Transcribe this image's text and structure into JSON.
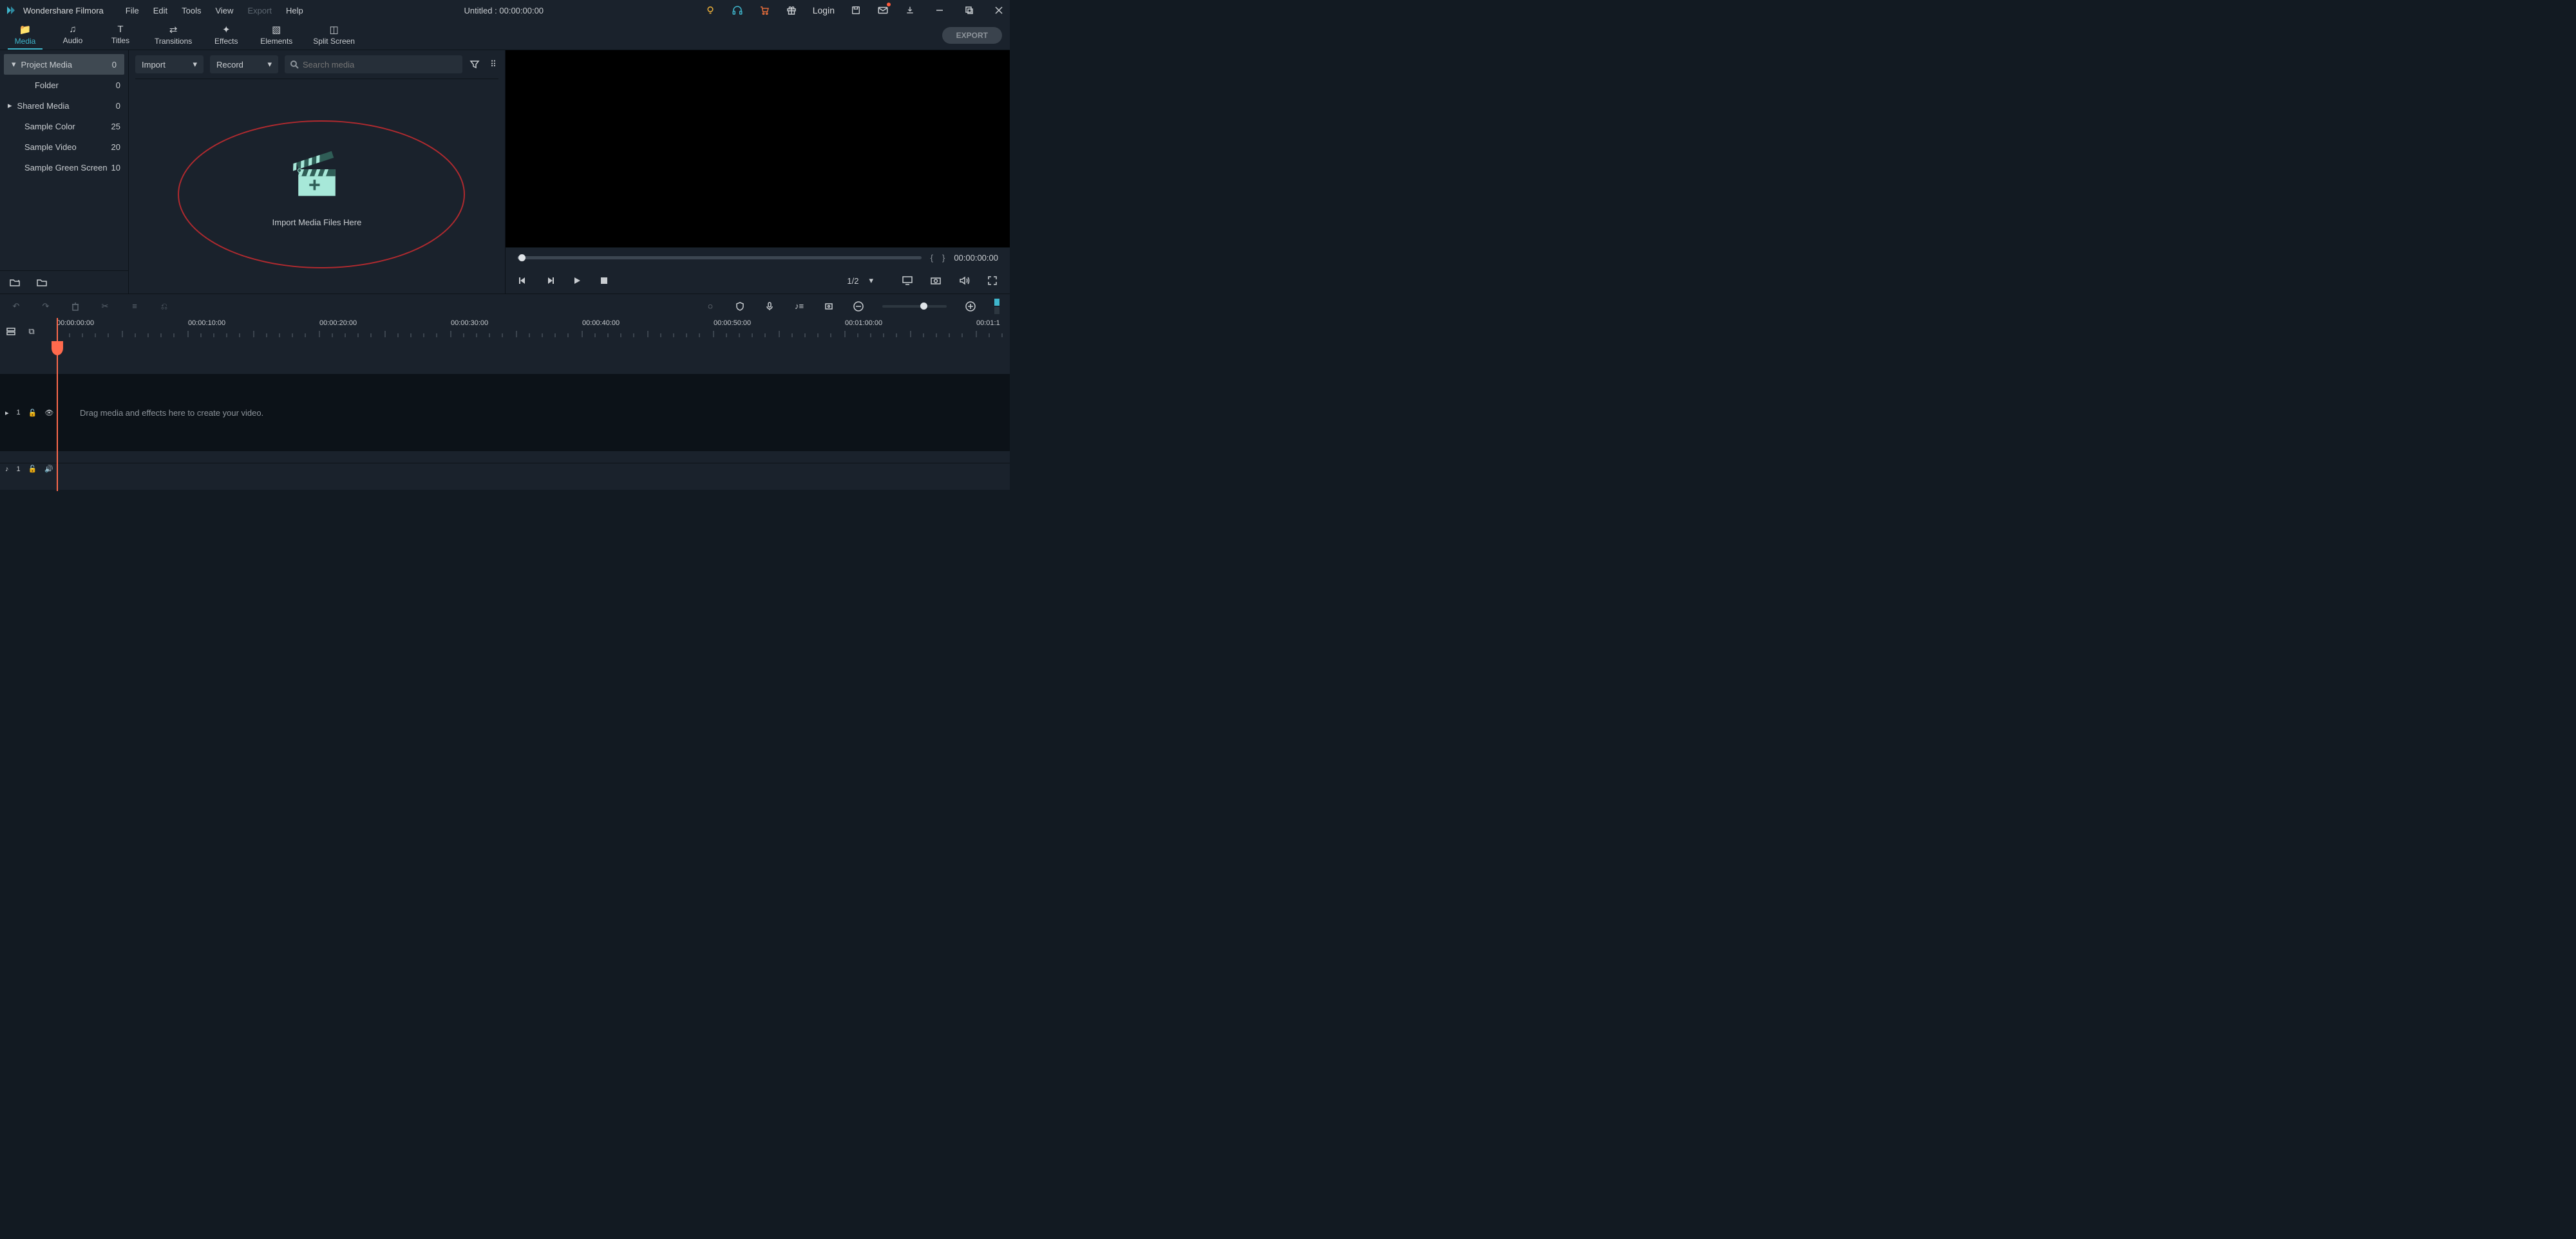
{
  "titlebar": {
    "app_name": "Wondershare Filmora",
    "menus": [
      "File",
      "Edit",
      "Tools",
      "View",
      "Export",
      "Help"
    ],
    "disabled_menu_index": 4,
    "center": "Untitled : 00:00:00:00",
    "login": "Login"
  },
  "tabs": {
    "items": [
      "Media",
      "Audio",
      "Titles",
      "Transitions",
      "Effects",
      "Elements",
      "Split Screen"
    ],
    "active_index": 0,
    "export_label": "EXPORT"
  },
  "sidebar": {
    "items": [
      {
        "label": "Project Media",
        "count": "0"
      },
      {
        "label": "Folder",
        "count": "0"
      },
      {
        "label": "Shared Media",
        "count": "0"
      },
      {
        "label": "Sample Color",
        "count": "25"
      },
      {
        "label": "Sample Video",
        "count": "20"
      },
      {
        "label": "Sample Green Screen",
        "count": "10"
      }
    ],
    "active_index": 0
  },
  "mediabar": {
    "import_label": "Import",
    "record_label": "Record",
    "search_placeholder": "Search media"
  },
  "drop_area": {
    "label": "Import Media Files Here"
  },
  "preview": {
    "timecode": "00:00:00:00",
    "ratio": "1/2"
  },
  "timeline": {
    "ruler": [
      "00:00:00:00",
      "00:00:10:00",
      "00:00:20:00",
      "00:00:30:00",
      "00:00:40:00",
      "00:00:50:00",
      "00:01:00:00",
      "00:01:1"
    ],
    "hint": "Drag media and effects here to create your video.",
    "video_track_label": "1",
    "audio_track_label": "1"
  }
}
